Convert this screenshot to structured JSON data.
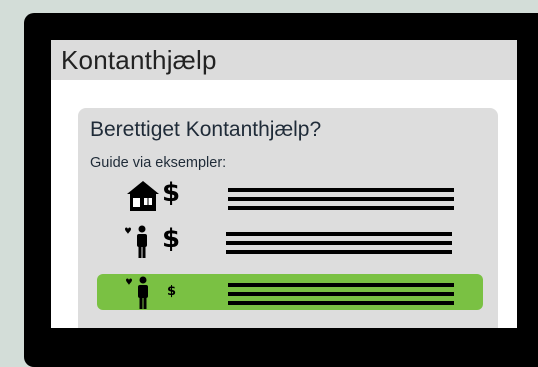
{
  "app": {
    "title": "Kontanthjælp"
  },
  "card": {
    "title": "Berettiget Kontanthjælp?",
    "guide_label": "Guide via eksempler:"
  },
  "examples": [
    {
      "icon": "house-icon",
      "currency": "$",
      "selected": false
    },
    {
      "icon": "person-heart-icon",
      "currency": "$",
      "selected": false
    },
    {
      "icon": "person-heart-icon",
      "currency": "$",
      "selected": true
    }
  ],
  "colors": {
    "background": "#d3ddd8",
    "device": "#000000",
    "selected": "#7ac143",
    "card": "#dddddd"
  }
}
